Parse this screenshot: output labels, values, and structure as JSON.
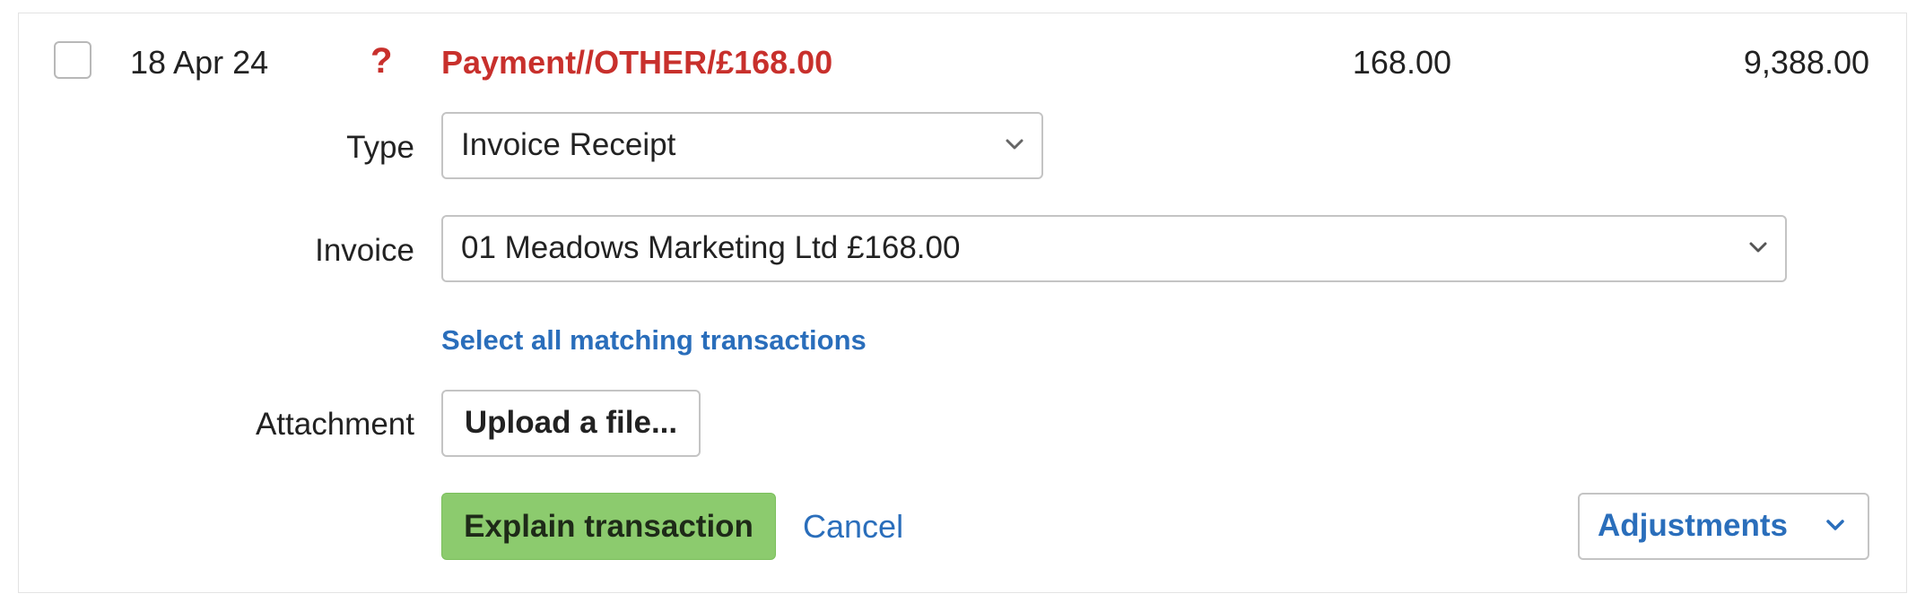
{
  "transaction": {
    "date": "18 Apr 24",
    "status_icon": "?",
    "description": "Payment//OTHER/£168.00",
    "amount": "168.00",
    "balance": "9,388.00"
  },
  "form": {
    "type_label": "Type",
    "type_value": "Invoice Receipt",
    "invoice_label": "Invoice",
    "invoice_value": "01 Meadows Marketing Ltd £168.00",
    "select_all_link": "Select all matching transactions",
    "attachment_label": "Attachment",
    "upload_button": "Upload a file..."
  },
  "actions": {
    "explain_button": "Explain transaction",
    "cancel_link": "Cancel",
    "adjustments_button": "Adjustments"
  },
  "colors": {
    "warning_red": "#c8302c",
    "link_blue": "#2a6ebb",
    "primary_green": "#8ccb6e"
  },
  "icons": {
    "status": "question-mark-icon",
    "dropdown": "chevron-down-icon"
  }
}
